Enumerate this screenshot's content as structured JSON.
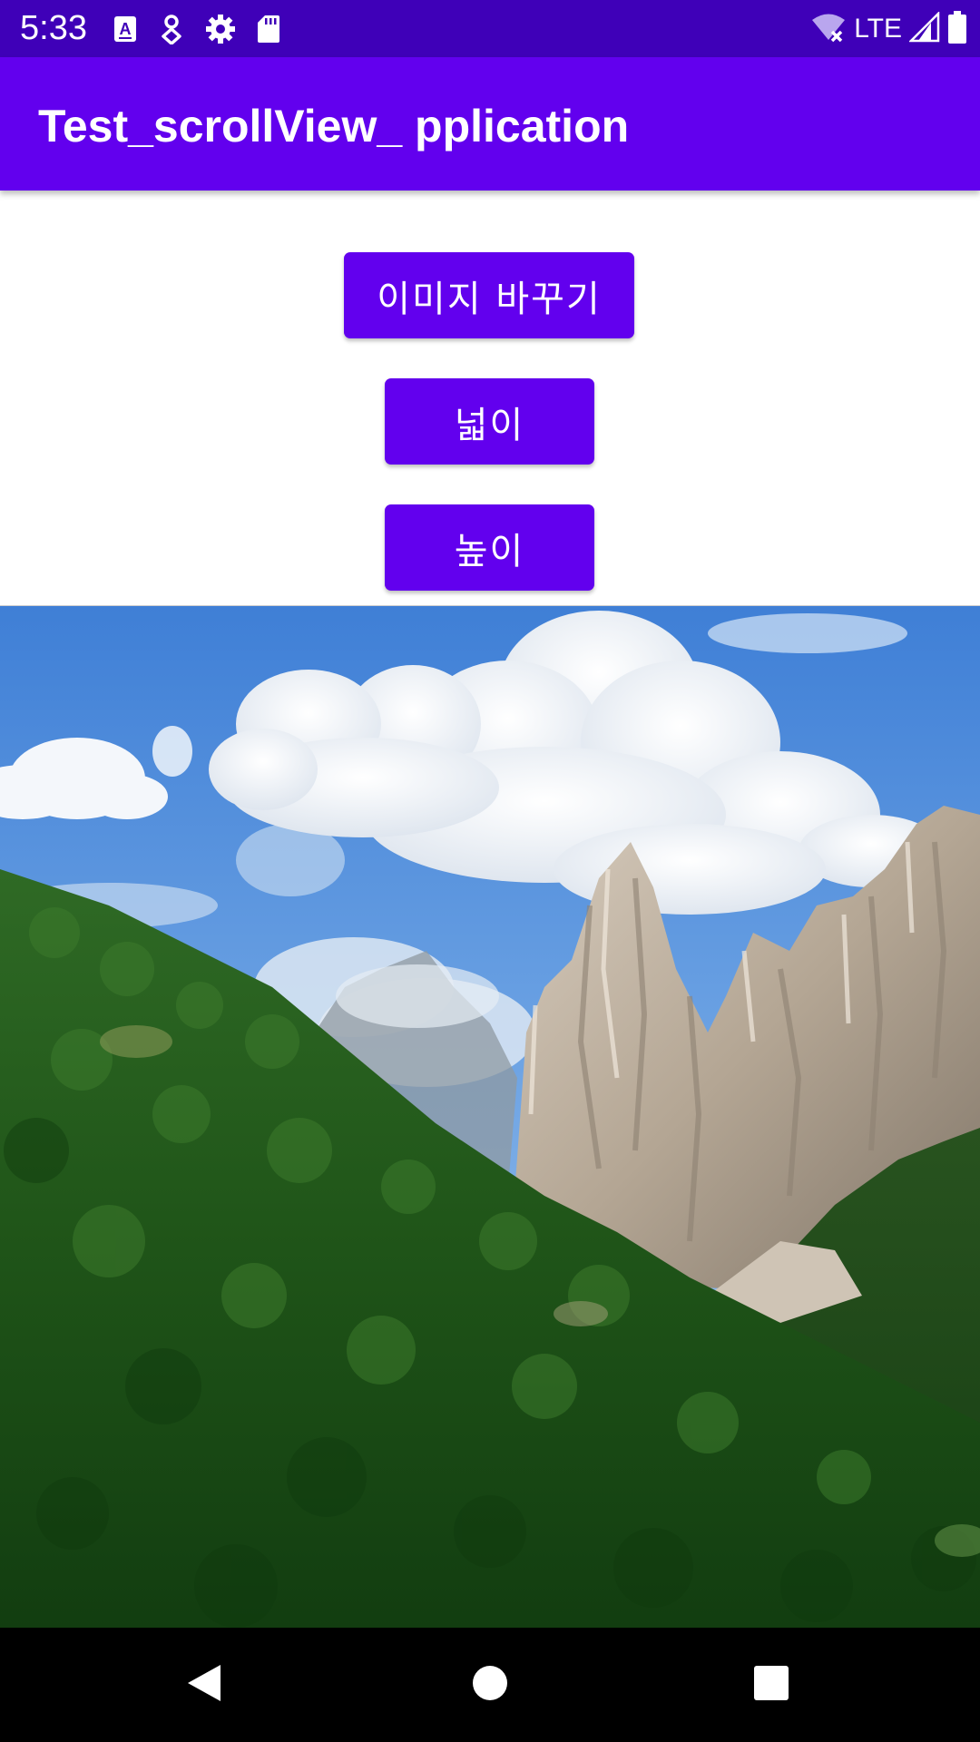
{
  "status_bar": {
    "time": "5:33",
    "left_icons": [
      "keyboard-a-icon",
      "location-pin-icon",
      "gear-icon",
      "sd-card-icon"
    ],
    "network_label": "LTE",
    "right_icons": [
      "wifi-off-icon",
      "cell-signal-icon",
      "battery-icon"
    ],
    "background_color": "#3f00b8"
  },
  "app_bar": {
    "title": "Test_scrollView_ pplication",
    "background_color": "#6200ee"
  },
  "buttons": {
    "change_image_label": "이미지 바꾸기",
    "width_label": "넓이",
    "height_label": "높이",
    "color": "#6200ee"
  },
  "image": {
    "subject": "mountain-landscape-photo"
  },
  "nav_bar": {
    "buttons": [
      "back-icon",
      "home-icon",
      "recent-apps-icon"
    ]
  }
}
